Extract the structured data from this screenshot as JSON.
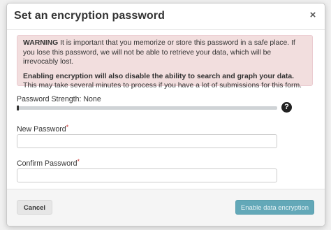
{
  "modal": {
    "title": "Set an encryption password",
    "close_glyph": "×",
    "close_icon": "close-icon"
  },
  "alert": {
    "warning_bold": "WARNING",
    "warning_text": " It is important that you memorize or store this password in a safe place. If you lose this password, we will not be able to retrieve your data, which will be irrevocably lost.",
    "notice_bold": "Enabling encryption will also disable the ability to search and graph your data.",
    "notice_text": " This may take several minutes to process if you have a lot of submissions for this form."
  },
  "strength": {
    "label": "Password Strength: None",
    "level": 0,
    "help_glyph": "?",
    "help_icon": "question-circle-icon"
  },
  "fields": {
    "new_password": {
      "label": "New Password",
      "required_mark": "*",
      "value": ""
    },
    "confirm_password": {
      "label": "Confirm Password",
      "required_mark": "*",
      "value": ""
    }
  },
  "footer": {
    "cancel_label": "Cancel",
    "enable_label": "Enable data encryption"
  },
  "colors": {
    "alert_background": "#f2dede",
    "alert_border": "#ebccd1",
    "required": "#c9302c",
    "primary_button": "#63a8b8",
    "footer_background": "#f5f5f5"
  }
}
